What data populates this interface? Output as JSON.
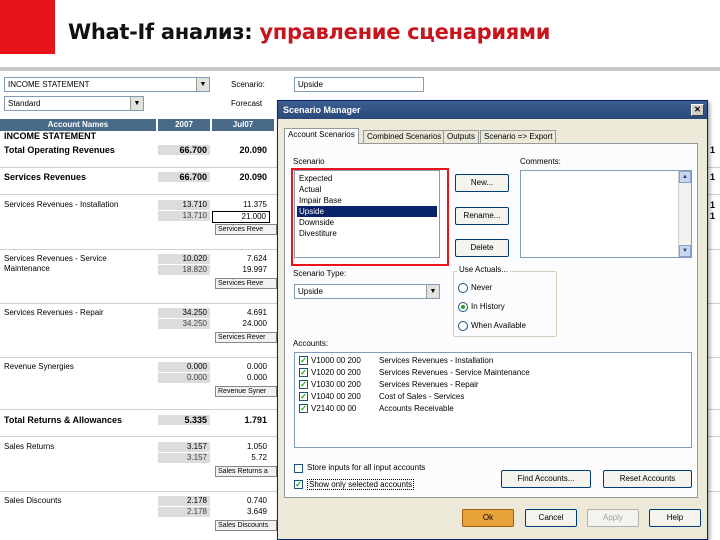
{
  "slide": {
    "title_black": "What-If анализ: ",
    "title_red": "управление сценариями",
    "accent_color": "#e8141c"
  },
  "sheet": {
    "statement_combo": "INCOME STATEMENT",
    "standard_combo": "Standard",
    "scenario_label": "Scenario:",
    "scenario_value": "Upside",
    "forecast_label": "Forecast",
    "col_headers": [
      "Account Names",
      "2007",
      "Jul07"
    ],
    "section_title": "INCOME STATEMENT",
    "rows": {
      "total_operating_revenues": {
        "label": "Total Operating Revenues",
        "v2007": "66.700",
        "vjul": "20.090"
      },
      "services_revenues": {
        "label": "Services Revenues",
        "v2007": "66.700",
        "vjul": "20.090"
      },
      "installation": {
        "label": "Services Revenues - Installation",
        "v1": "13.710",
        "v2": "13.710",
        "j1": "11.375",
        "j2": "21.000",
        "note": "Services Reve"
      },
      "maintenance": {
        "label": "Services Revenues - Service Maintenance",
        "v1": "10.020",
        "v2": "18.820",
        "j1": "7.624",
        "j2": "19.997",
        "note": "Services Reve"
      },
      "repair": {
        "label": "Services Revenues - Repair",
        "v1": "34.250",
        "v2": "34.250",
        "j1": "4.691",
        "j2": "24.000",
        "note": "Services Rever"
      },
      "synergies": {
        "label": "Revenue Synergies",
        "v1": "0.000",
        "v2": "0.000",
        "j1": "0.000",
        "j2": "0.000",
        "note": "Revenue Syner"
      },
      "total_returns": {
        "label": "Total Returns & Allowances",
        "v2007": "5.335",
        "vjul": "1.791"
      },
      "sales_returns": {
        "label": "Sales Returns",
        "v1": "3.157",
        "v2": "3.157",
        "j1": "1.050",
        "j2": "5.72",
        "note": "Sales Returns a"
      },
      "sales_discounts": {
        "label": "Sales Discounts",
        "v1": "2.178",
        "v2": "2.178",
        "j1": "0.740",
        "j2": "3.649",
        "note": "Sales Discounts"
      }
    },
    "right_edge_values": [
      "1",
      "1",
      "1",
      "1"
    ]
  },
  "dialog": {
    "title": "Scenario Manager",
    "close_glyph": "✕",
    "tabs": [
      "Account Scenarios",
      "Combined Scenarios",
      "Outputs",
      "Scenario => Export"
    ],
    "scenario_label": "Scenario",
    "comments_label": "Comments:",
    "scenarios": [
      "Expected",
      "Actual",
      "Impair Base",
      "Upside",
      "Downside",
      "Divestiture"
    ],
    "selected_scenario": "Upside",
    "new_button": "New...",
    "rename_button": "Rename...",
    "delete_button": "Delete",
    "scenario_type_label": "Scenario Type:",
    "scenario_type_value": "Upside",
    "use_actuals_label": "Use Actuals...",
    "radio_never": "Never",
    "radio_history": "In History",
    "radio_when": "When Available",
    "accounts_label": "Accounts:",
    "accounts": [
      {
        "code": "V1000 00 200",
        "desc": "Services Revenues - Installation"
      },
      {
        "code": "V1020 00 200",
        "desc": "Services Revenues - Service Maintenance"
      },
      {
        "code": "V1030 00 200",
        "desc": "Services Revenues - Repair"
      },
      {
        "code": "V1040 00 200",
        "desc": "Cost of Sales - Services"
      },
      {
        "code": "V2140 00 00",
        "desc": "Accounts Receivable"
      }
    ],
    "store_inputs_label": "Store inputs for all input accounts",
    "show_selected_label": "Show only selected accounts",
    "find_accounts_button": "Find Accounts...",
    "reset_accounts_button": "Reset Accounts",
    "ok_button": "Ok",
    "cancel_button": "Cancel",
    "apply_button": "Apply",
    "help_button": "Help"
  }
}
